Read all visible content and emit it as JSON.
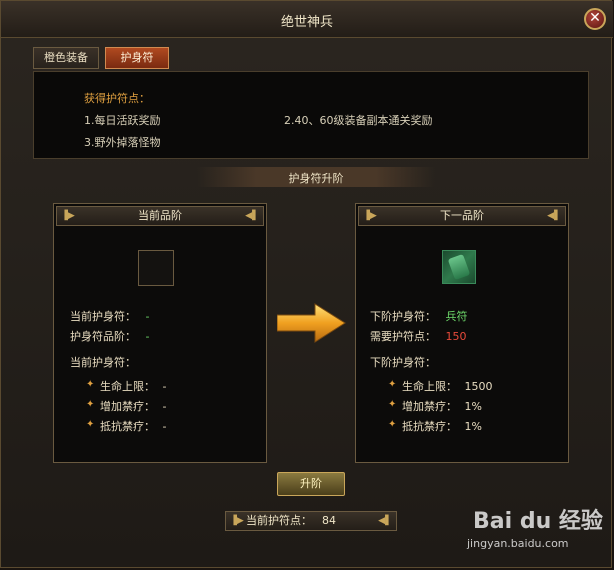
{
  "window": {
    "title": "绝世神兵",
    "close_label": "✕"
  },
  "tabs": [
    {
      "label": "橙色装备",
      "active": false
    },
    {
      "label": "护身符",
      "active": true
    }
  ],
  "info": {
    "title": "获得护符点：",
    "lines": [
      "1.每日活跃奖励",
      "2.40、60级装备副本通关奖励",
      "3.野外掉落怪物"
    ]
  },
  "section": {
    "title": "护身符升阶"
  },
  "current": {
    "header": "当前品阶",
    "amulet_label": "当前护身符：",
    "amulet_value": "-",
    "grade_label": "护身符品阶：",
    "grade_value": "-",
    "attrs_title": "当前护身符：",
    "attrs": [
      {
        "label": "生命上限：",
        "value": "-"
      },
      {
        "label": "增加禁疗：",
        "value": "-"
      },
      {
        "label": "抵抗禁疗：",
        "value": "-"
      }
    ]
  },
  "next": {
    "header": "下一品阶",
    "amulet_label": "下阶护身符：",
    "amulet_value": "兵符",
    "need_label": "需要护符点：",
    "need_value": "150",
    "attrs_title": "下阶护身符：",
    "attrs": [
      {
        "label": "生命上限：",
        "value": "1500"
      },
      {
        "label": "增加禁疗：",
        "value": "1%"
      },
      {
        "label": "抵抗禁疗：",
        "value": "1%"
      }
    ]
  },
  "upgrade_button": "升阶",
  "points": {
    "label": "当前护符点：",
    "value": "84"
  },
  "watermark": {
    "logo": "Bai du 经验",
    "url": "jingyan.baidu.com"
  },
  "colors": {
    "accent": "#e0a040",
    "green": "#6ed86a",
    "red": "#e84a3a",
    "tab_active": "#b04a20"
  }
}
